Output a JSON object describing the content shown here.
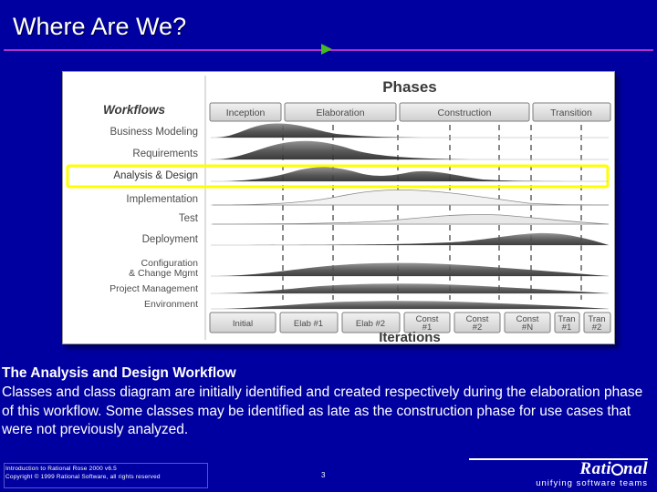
{
  "slide": {
    "title": "Where Are We?",
    "page_number": "3"
  },
  "diagram": {
    "phases_label": "Phases",
    "workflows_label": "Workflows",
    "iterations_label": "Iterations",
    "phases": [
      "Inception",
      "Elaboration",
      "Construction",
      "Transition"
    ],
    "workflows": [
      "Business Modeling",
      "Requirements",
      "Analysis & Design",
      "Implementation",
      "Test",
      "Deployment",
      "Configuration\n& Change Mgmt",
      "Project Management",
      "Environment"
    ],
    "workflow_rows": [
      {
        "label": "Business Modeling",
        "highlight": false
      },
      {
        "label": "Requirements",
        "highlight": false
      },
      {
        "label": "Analysis & Design",
        "highlight": true
      },
      {
        "label": "Implementation",
        "highlight": false
      },
      {
        "label": "Test",
        "highlight": false
      },
      {
        "label": "Deployment",
        "highlight": false
      },
      {
        "label": "Configuration",
        "label2": "& Change Mgmt",
        "highlight": false
      },
      {
        "label": "Project Management",
        "highlight": false
      },
      {
        "label": "Environment",
        "highlight": false
      }
    ],
    "iterations": [
      "Initial",
      "Elab #1",
      "Elab #2",
      "Const #1",
      "Const #2",
      "Const #N",
      "Tran #1",
      "Tran #2"
    ],
    "iteration_lines": [
      [
        "Initial"
      ],
      [
        "Elab #1"
      ],
      [
        "Elab #2"
      ],
      [
        "Const",
        "#1"
      ],
      [
        "Const",
        "#2"
      ],
      [
        "Const",
        "#N"
      ],
      [
        "Tran",
        "#1"
      ],
      [
        "Tran",
        "#2"
      ]
    ],
    "highlight_color": "#ffff00"
  },
  "body": {
    "heading": "The Analysis and Design Workflow",
    "paragraph": "Classes and class diagram are initially identified and created respectively during the elaboration phase of this workflow. Some classes may be identified as late as the construction phase for use cases that were not previously analyzed."
  },
  "footer": {
    "line1": "Introduction to Rational Rose 2000 v6.5",
    "line2": "Copyright © 1999 Rational Software, all rights reserved",
    "logo_text_left": "Rati",
    "logo_text_right": "nal",
    "logo_tagline": "unifying software teams"
  },
  "colors": {
    "background": "#0000a0",
    "title_text": "#ffffff",
    "rule": "#b030d0",
    "arrow": "#44bb22",
    "panel": "#ffffff",
    "highlight": "#ffff00"
  }
}
